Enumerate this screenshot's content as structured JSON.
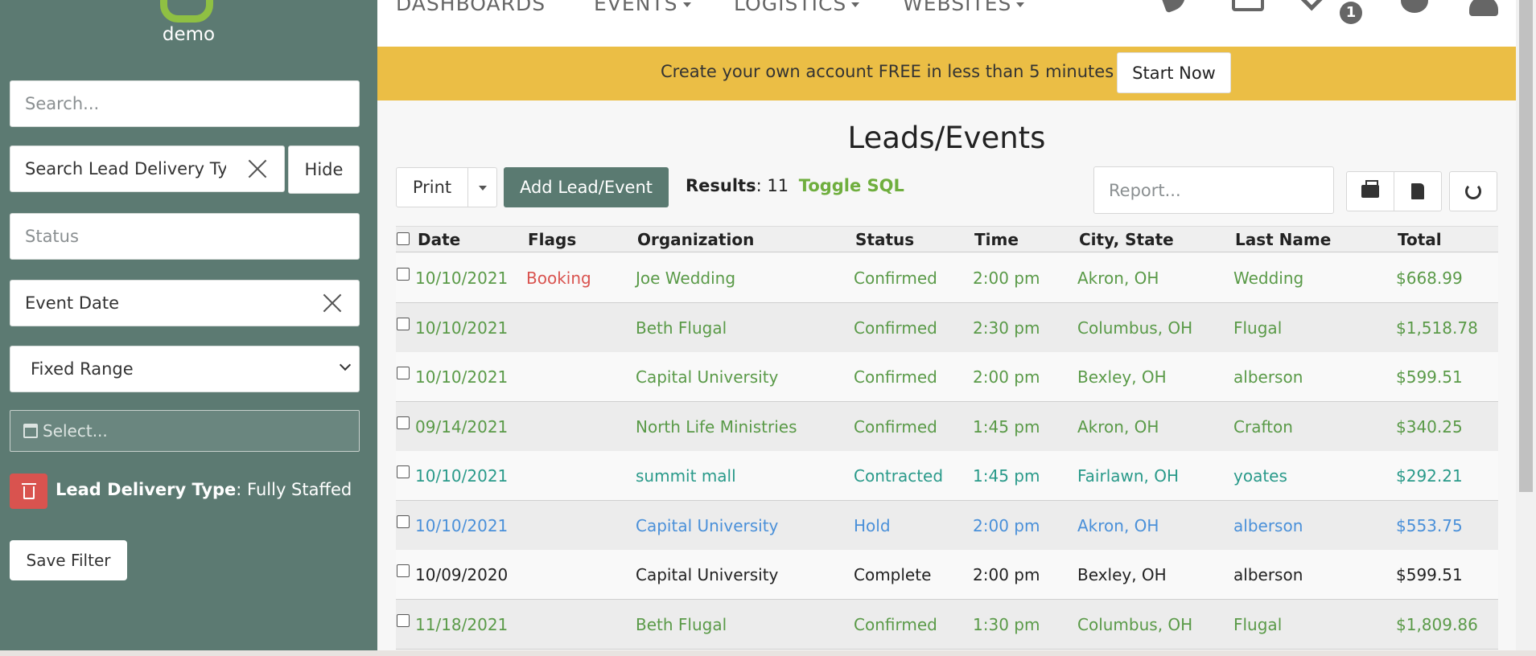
{
  "sidebar": {
    "logo_text": "demo",
    "search_placeholder": "Search...",
    "lead_delivery_value": "Search Lead Delivery Ty",
    "hide_label": "Hide",
    "status_placeholder": "Status",
    "event_date_value": "Event Date",
    "range_value": "Fixed Range",
    "date_placeholder": "Select...",
    "active_filter": {
      "label": "Lead Delivery Type",
      "value": ": Fully Staffed"
    },
    "save_filter_label": "Save Filter"
  },
  "nav": {
    "items": [
      {
        "label": "DASHBOARDS",
        "dropdown": false
      },
      {
        "label": "EVENTS",
        "dropdown": true
      },
      {
        "label": "LOGISTICS",
        "dropdown": true
      },
      {
        "label": "WEBSITES",
        "dropdown": true
      }
    ],
    "icons": [
      "phone-icon",
      "mail-icon",
      "heart-icon",
      "gear-icon",
      "user-icon"
    ],
    "badge": "1"
  },
  "banner": {
    "text": "Create your own account FREE in less than 5 minutes",
    "button": "Start Now",
    "color": "#ebbe45"
  },
  "main": {
    "title": "Leads/Events",
    "print_label": "Print",
    "add_label": "Add Lead/Event",
    "results_label": "Results",
    "results_count": ": 11",
    "toggle_sql": "Toggle SQL",
    "report_placeholder": "Report..."
  },
  "table": {
    "columns": [
      "Date",
      "Flags",
      "Organization",
      "Status",
      "Time",
      "City, State",
      "Last Name",
      "Total"
    ],
    "rows": [
      {
        "date": "10/10/2021",
        "flag": "Booking",
        "org": "Joe Wedding",
        "status": "Confirmed",
        "time": "2:00 pm",
        "city": "Akron, OH",
        "last": "Wedding",
        "total": "$668.99",
        "color": "#5a9a48"
      },
      {
        "date": "10/10/2021",
        "flag": "",
        "org": "Beth Flugal",
        "status": "Confirmed",
        "time": "2:30 pm",
        "city": "Columbus, OH",
        "last": "Flugal",
        "total": "$1,518.78",
        "color": "#5a9a48"
      },
      {
        "date": "10/10/2021",
        "flag": "",
        "org": "Capital University",
        "status": "Confirmed",
        "time": "2:00 pm",
        "city": "Bexley, OH",
        "last": "alberson",
        "total": "$599.51",
        "color": "#5a9a48"
      },
      {
        "date": "09/14/2021",
        "flag": "",
        "org": "North Life Ministries",
        "status": "Confirmed",
        "time": "1:45 pm",
        "city": "Akron, OH",
        "last": "Crafton",
        "total": "$340.25",
        "color": "#5a9a48"
      },
      {
        "date": "10/10/2021",
        "flag": "",
        "org": "summit mall",
        "status": "Contracted",
        "time": "1:45 pm",
        "city": "Fairlawn, OH",
        "last": "yoates",
        "total": "$292.21",
        "color": "#2a9a8a"
      },
      {
        "date": "10/10/2021",
        "flag": "",
        "org": "Capital University",
        "status": "Hold",
        "time": "2:00 pm",
        "city": "Akron, OH",
        "last": "alberson",
        "total": "$553.75",
        "color": "#4a90d9"
      },
      {
        "date": "10/09/2020",
        "flag": "",
        "org": "Capital University",
        "status": "Complete",
        "time": "2:00 pm",
        "city": "Bexley, OH",
        "last": "alberson",
        "total": "$599.51",
        "color": "#222222"
      },
      {
        "date": "11/18/2021",
        "flag": "",
        "org": "Beth Flugal",
        "status": "Confirmed",
        "time": "1:30 pm",
        "city": "Columbus, OH",
        "last": "Flugal",
        "total": "$1,809.86",
        "color": "#5a9a48"
      }
    ],
    "flag_color": "#d9534f"
  }
}
